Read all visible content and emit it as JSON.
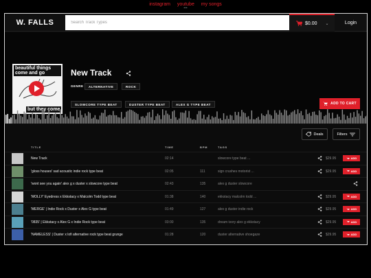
{
  "top_nav": [
    "instagram",
    "youtube",
    "my songs"
  ],
  "brand": "W. FALLS",
  "search": {
    "placeholder": "Search Track Types"
  },
  "cart": {
    "total": "$0.00"
  },
  "login_label": "Login",
  "track": {
    "title": "New Track",
    "genre_label": "GENRE",
    "genres": [
      "ALTERNATIVE",
      "ROCK"
    ],
    "type_tags": [
      "SLOWCORE TYPE BEAT",
      "DUSTER TYPE BEAT",
      "ALEX G TYPE BEAT"
    ],
    "cover_text_top": "beautiful things come and go",
    "cover_text_bottom": "but they come"
  },
  "add_to_cart_label": "ADD TO CART",
  "deals_label": "Deals",
  "filters_label": "Filters",
  "table_headers": {
    "title": "TITLE",
    "time": "TIME",
    "bpm": "BPM",
    "tags": "TAGS"
  },
  "rows": [
    {
      "title": "New Track",
      "time": "02:14",
      "bpm": "",
      "tags": "slowcore type beat ...",
      "price": "$29.95",
      "add": "ADD",
      "thumb": "#c8c8c8"
    },
    {
      "title": "'gloss houses' sad acoustic indie rock type beat",
      "time": "02:05",
      "bpm": "111",
      "tags": "sign crushes motorist ...",
      "price": "$29.95",
      "add": "ADD",
      "thumb": "#6f8f6a"
    },
    {
      "title": "'wont see you again' alex g x duster x slowcore type beat",
      "time": "02:43",
      "bpm": "135",
      "tags": "alex g  duster  slowcore",
      "price": "",
      "add": "",
      "thumb": "#3d6a4c"
    },
    {
      "title": "'MOLLY' Eyedress x Ekkstacy x Malcolm Todd type beat",
      "time": "01:38",
      "bpm": "140",
      "tags": "ekkstacy  malcolm todd ...",
      "price": "$29.95",
      "add": "ADD",
      "thumb": "#d6d6d6"
    },
    {
      "title": "'MERGE' | Indie Rock x Duster x Alex G type beat",
      "time": "01:49",
      "bpm": "127",
      "tags": "alex g  duster  indie rock",
      "price": "$29.95",
      "add": "ADD",
      "thumb": "#4c7f8f"
    },
    {
      "title": "'0835' | Ekkstacy x Alex G x Indie Rock type beat",
      "time": "03:00",
      "bpm": "135",
      "tags": "dream ivory  alex g  ekkstacy",
      "price": "$29.95",
      "add": "ADD",
      "thumb": "#5aa0b8"
    },
    {
      "title": "'NAMELESS' | Duster x lofi alternative rock type beat grunge",
      "time": "01:28",
      "bpm": "120",
      "tags": "duster  alternative  shoegaze",
      "price": "$29.95",
      "add": "ADD",
      "thumb": "#3c5fa8"
    }
  ],
  "colors": {
    "accent": "#e0202a",
    "background": "#0c0c0c"
  },
  "icons": [
    "cart-icon",
    "share-icon",
    "tag-icon",
    "filter-icon",
    "play-icon"
  ]
}
